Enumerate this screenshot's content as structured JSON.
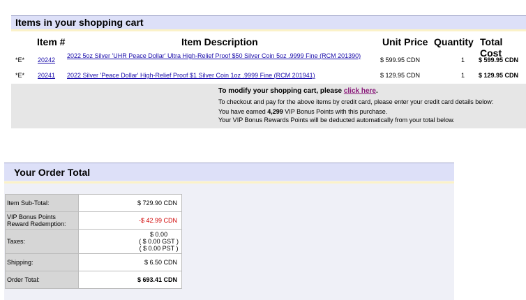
{
  "cart": {
    "title": "Items in your shopping cart",
    "columns": {
      "item": "Item #",
      "description": "Item Description",
      "unit_price": "Unit Price",
      "quantity": "Quantity",
      "total_cost": "Total Cost"
    },
    "rows": [
      {
        "marker": "*E*",
        "item_number": "20242",
        "description": "2022 5oz Silver 'UHR Peace Dollar' Ultra High-Relief Proof $50 Silver Coin 5oz .9999 Fine (RCM 201390)",
        "unit_price": "$ 599.95 CDN",
        "quantity": "1",
        "total_cost": "$ 599.95 CDN"
      },
      {
        "marker": "*E*",
        "item_number": "20241",
        "description": "2022 Silver 'Peace Dollar' High-Relief Proof $1 Silver Coin 1oz .9999 Fine (RCM 201941)",
        "unit_price": "$ 129.95 CDN",
        "quantity": "1",
        "total_cost": "$ 129.95 CDN"
      }
    ],
    "notes": {
      "modify_prefix": "To modify your shopping cart, please",
      "modify_link": "click here",
      "modify_suffix": ".",
      "checkout": "To checkout and pay for the above items by credit card, please enter your credit card details below:",
      "earned_prefix": "You have earned",
      "earned_points": "4,299",
      "earned_suffix": "VIP Bonus Points with this purchase.",
      "deducted": "Your VIP Bonus Rewards Points will be deducted automatically from your total below."
    }
  },
  "order": {
    "title": "Your Order Total",
    "subtotal_label": "Item Sub-Total:",
    "subtotal_value": "$ 729.90  CDN",
    "vip_label_1": "VIP Bonus Points",
    "vip_label_2": "Reward Redemption:",
    "vip_value": "-$ 42.99  CDN",
    "taxes_label": "Taxes:",
    "taxes_total": "$ 0.00",
    "taxes_gst": "( $ 0.00 GST )",
    "taxes_pst": "( $ 0.00 PST )",
    "shipping_label": "Shipping:",
    "shipping_value": "$ 6.50  CDN",
    "total_label": "Order Total:",
    "total_value": "$ 693.41 CDN"
  }
}
